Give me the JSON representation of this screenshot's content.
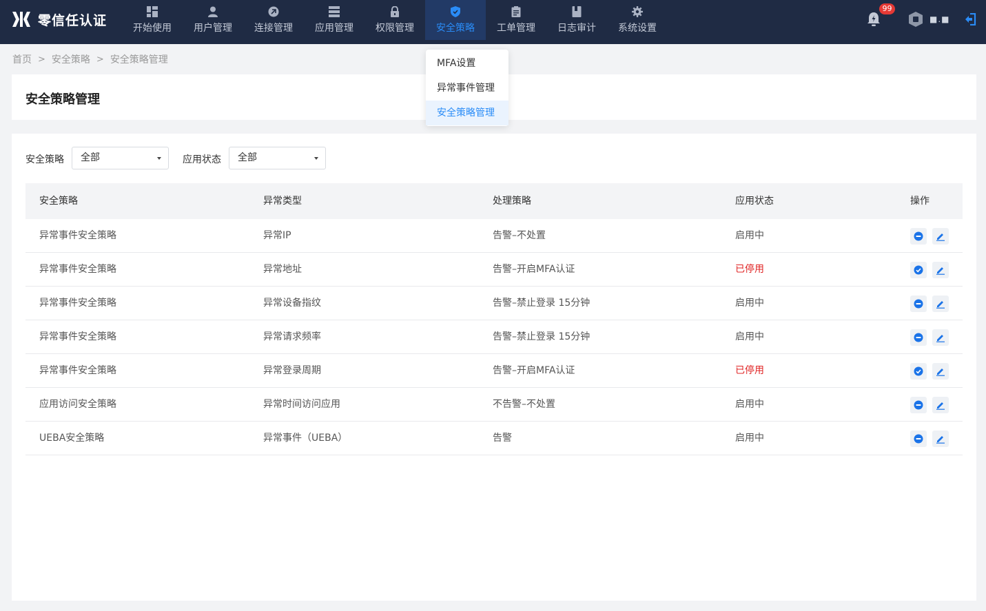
{
  "app": {
    "name": "零信任认证"
  },
  "nav": [
    {
      "label": "开始使用",
      "icon": "dashboard-icon"
    },
    {
      "label": "用户管理",
      "icon": "user-icon"
    },
    {
      "label": "连接管理",
      "icon": "connection-icon"
    },
    {
      "label": "应用管理",
      "icon": "server-icon"
    },
    {
      "label": "权限管理",
      "icon": "lock-icon"
    },
    {
      "label": "安全策略",
      "icon": "shield-icon",
      "active": true
    },
    {
      "label": "工单管理",
      "icon": "clipboard-icon"
    },
    {
      "label": "日志审计",
      "icon": "book-icon"
    },
    {
      "label": "系统设置",
      "icon": "gear-icon"
    }
  ],
  "header": {
    "notification_count": "99",
    "username": "■.■"
  },
  "dropdown": [
    {
      "label": "MFA设置"
    },
    {
      "label": "异常事件管理"
    },
    {
      "label": "安全策略管理",
      "active": true
    }
  ],
  "breadcrumb": [
    "首页",
    "安全策略",
    "安全策略管理"
  ],
  "page": {
    "title": "安全策略管理"
  },
  "filters": {
    "policy_label": "安全策略",
    "policy_value": "全部",
    "status_label": "应用状态",
    "status_value": "全部"
  },
  "table": {
    "columns": [
      "安全策略",
      "异常类型",
      "处理策略",
      "应用状态",
      "操作"
    ],
    "rows": [
      {
        "policy": "异常事件安全策略",
        "type": "异常IP",
        "action": "告警–不处置",
        "status": "启用中",
        "enabled": true
      },
      {
        "policy": "异常事件安全策略",
        "type": "异常地址",
        "action": "告警–开启MFA认证",
        "status": "已停用",
        "enabled": false
      },
      {
        "policy": "异常事件安全策略",
        "type": "异常设备指纹",
        "action": "告警–禁止登录 15分钟",
        "status": "启用中",
        "enabled": true
      },
      {
        "policy": "异常事件安全策略",
        "type": "异常请求频率",
        "action": "告警–禁止登录 15分钟",
        "status": "启用中",
        "enabled": true
      },
      {
        "policy": "异常事件安全策略",
        "type": "异常登录周期",
        "action": "告警–开启MFA认证",
        "status": "已停用",
        "enabled": false
      },
      {
        "policy": "应用访问安全策略",
        "type": "异常时间访问应用",
        "action": "不告警–不处置",
        "status": "启用中",
        "enabled": true
      },
      {
        "policy": "UEBA安全策略",
        "type": "异常事件（UEBA）",
        "action": "告警",
        "status": "启用中",
        "enabled": true
      }
    ]
  },
  "colors": {
    "nav_bg": "#1f2b44",
    "accent": "#2a8cf7",
    "danger": "#e02424",
    "badge": "#e53935"
  }
}
